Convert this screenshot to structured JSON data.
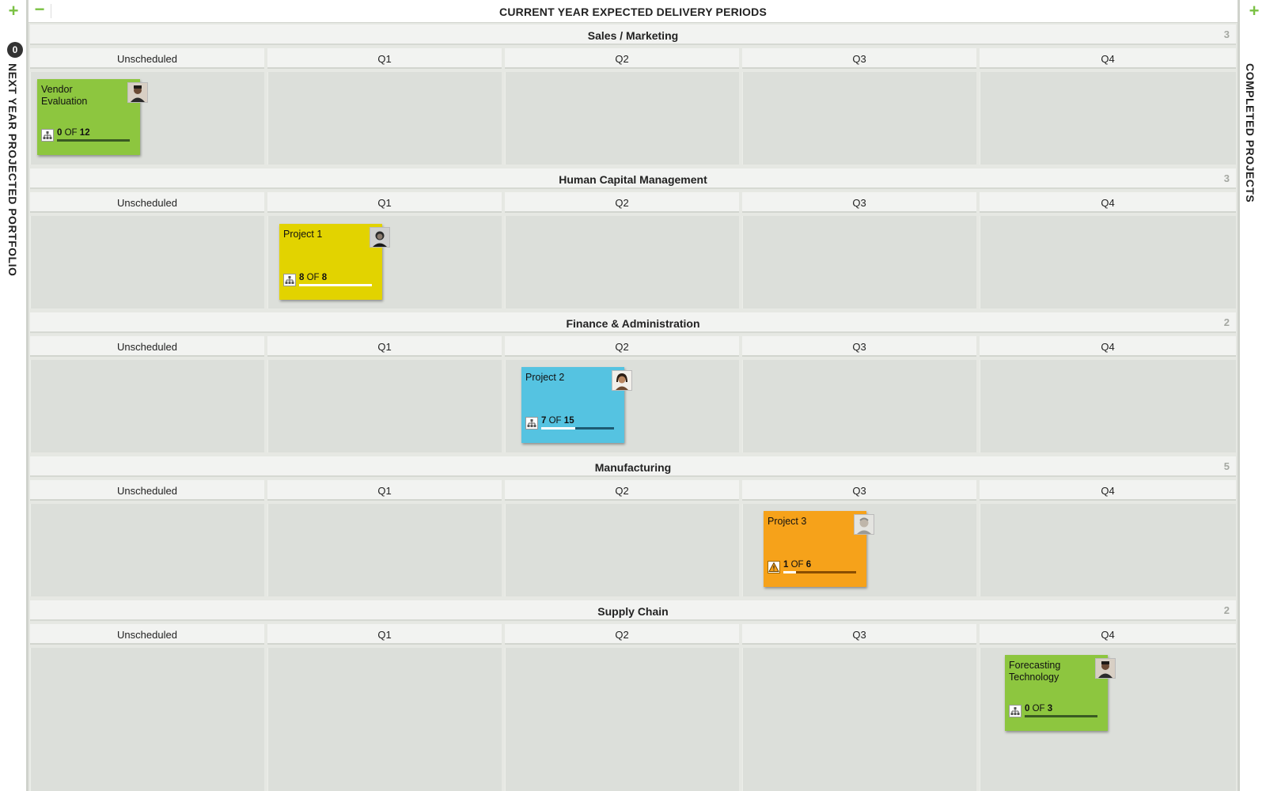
{
  "left_rail": {
    "add_label": "+",
    "count": "0",
    "title": "NEXT YEAR PROJECTED PORTFOLIO"
  },
  "right_rail": {
    "add_label": "+",
    "title": "COMPLETED PROJECTS"
  },
  "board": {
    "collapse_label": "−",
    "title": "CURRENT YEAR EXPECTED DELIVERY PERIODS"
  },
  "columns": [
    "Unscheduled",
    "Q1",
    "Q2",
    "Q3",
    "Q4"
  ],
  "sections": [
    {
      "title": "Sales / Marketing",
      "count": "3"
    },
    {
      "title": "Human Capital Management",
      "count": "3"
    },
    {
      "title": "Finance & Administration",
      "count": "2"
    },
    {
      "title": "Manufacturing",
      "count": "5"
    },
    {
      "title": "Supply Chain",
      "count": "2"
    }
  ],
  "cards": [
    {
      "name": "Vendor Evaluation",
      "done": "0",
      "of": "OF",
      "total": "12",
      "fraction": 0.0,
      "color": "#8dc63f",
      "bar": "#3a5a22",
      "icon": "org-chart-icon",
      "avatar": "avatar-man-icon"
    },
    {
      "name": "Project 1",
      "done": "8",
      "of": "OF",
      "total": "8",
      "fraction": 1.0,
      "color": "#e2d300",
      "bar": "#6b6400",
      "icon": "org-chart-icon",
      "avatar": "avatar-person-icon"
    },
    {
      "name": "Project 2",
      "done": "7",
      "of": "OF",
      "total": "15",
      "fraction": 0.467,
      "color": "#55c3e1",
      "bar": "#1d5a72",
      "icon": "org-chart-icon",
      "avatar": "avatar-woman-icon"
    },
    {
      "name": "Project 3",
      "done": "1",
      "of": "OF",
      "total": "6",
      "fraction": 0.167,
      "color": "#f6a21a",
      "bar": "#8a4e00",
      "icon": "warning-icon",
      "avatar": "avatar-man-icon"
    },
    {
      "name": "Forecasting Technology",
      "done": "0",
      "of": "OF",
      "total": "3",
      "fraction": 0.0,
      "color": "#8dc63f",
      "bar": "#3a5a22",
      "icon": "org-chart-icon",
      "avatar": "avatar-man-icon"
    }
  ]
}
